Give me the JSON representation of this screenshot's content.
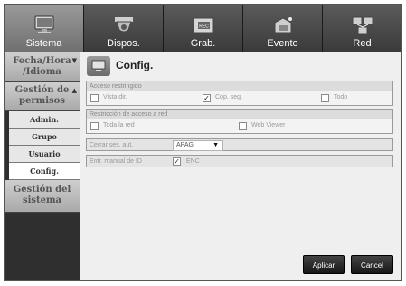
{
  "tabs": [
    {
      "label": "Sistema",
      "icon": "monitor-icon",
      "active": true
    },
    {
      "label": "Dispos.",
      "icon": "camera-icon",
      "active": false
    },
    {
      "label": "Grab.",
      "icon": "rec-icon",
      "active": false
    },
    {
      "label": "Evento",
      "icon": "event-icon",
      "active": false
    },
    {
      "label": "Red",
      "icon": "network-icon",
      "active": false
    }
  ],
  "sidebar": {
    "group1": "Fecha/Hora /Idioma",
    "group2": "Gestión de permisos",
    "items": [
      "Admin.",
      "Grupo",
      "Usuario",
      "Config."
    ],
    "group3": "Gestión del sistema"
  },
  "main": {
    "title": "Config.",
    "access": {
      "header": "Acceso restringido",
      "options": [
        {
          "label": "Vista dir.",
          "checked": false
        },
        {
          "label": "Cop. seg.",
          "checked": true
        },
        {
          "label": "Todo",
          "checked": false
        }
      ]
    },
    "network": {
      "header": "Restricción de acceso a red",
      "options": [
        {
          "label": "Toda la red",
          "checked": false
        },
        {
          "label": "Web Viewer",
          "checked": false
        }
      ]
    },
    "logout": {
      "label": "Cerrar ses. aut.",
      "value": "APAG"
    },
    "manual_id": {
      "label": "Entr. manual de ID",
      "checkbox_label": "ENC",
      "checked": true
    },
    "apply_label": "Aplicar",
    "cancel_label": "Cancel"
  },
  "colors": {
    "active_tab": "#8a8a8a",
    "tabbar": "#3a3a3a",
    "sidebar_group": "#bdbdbd"
  }
}
